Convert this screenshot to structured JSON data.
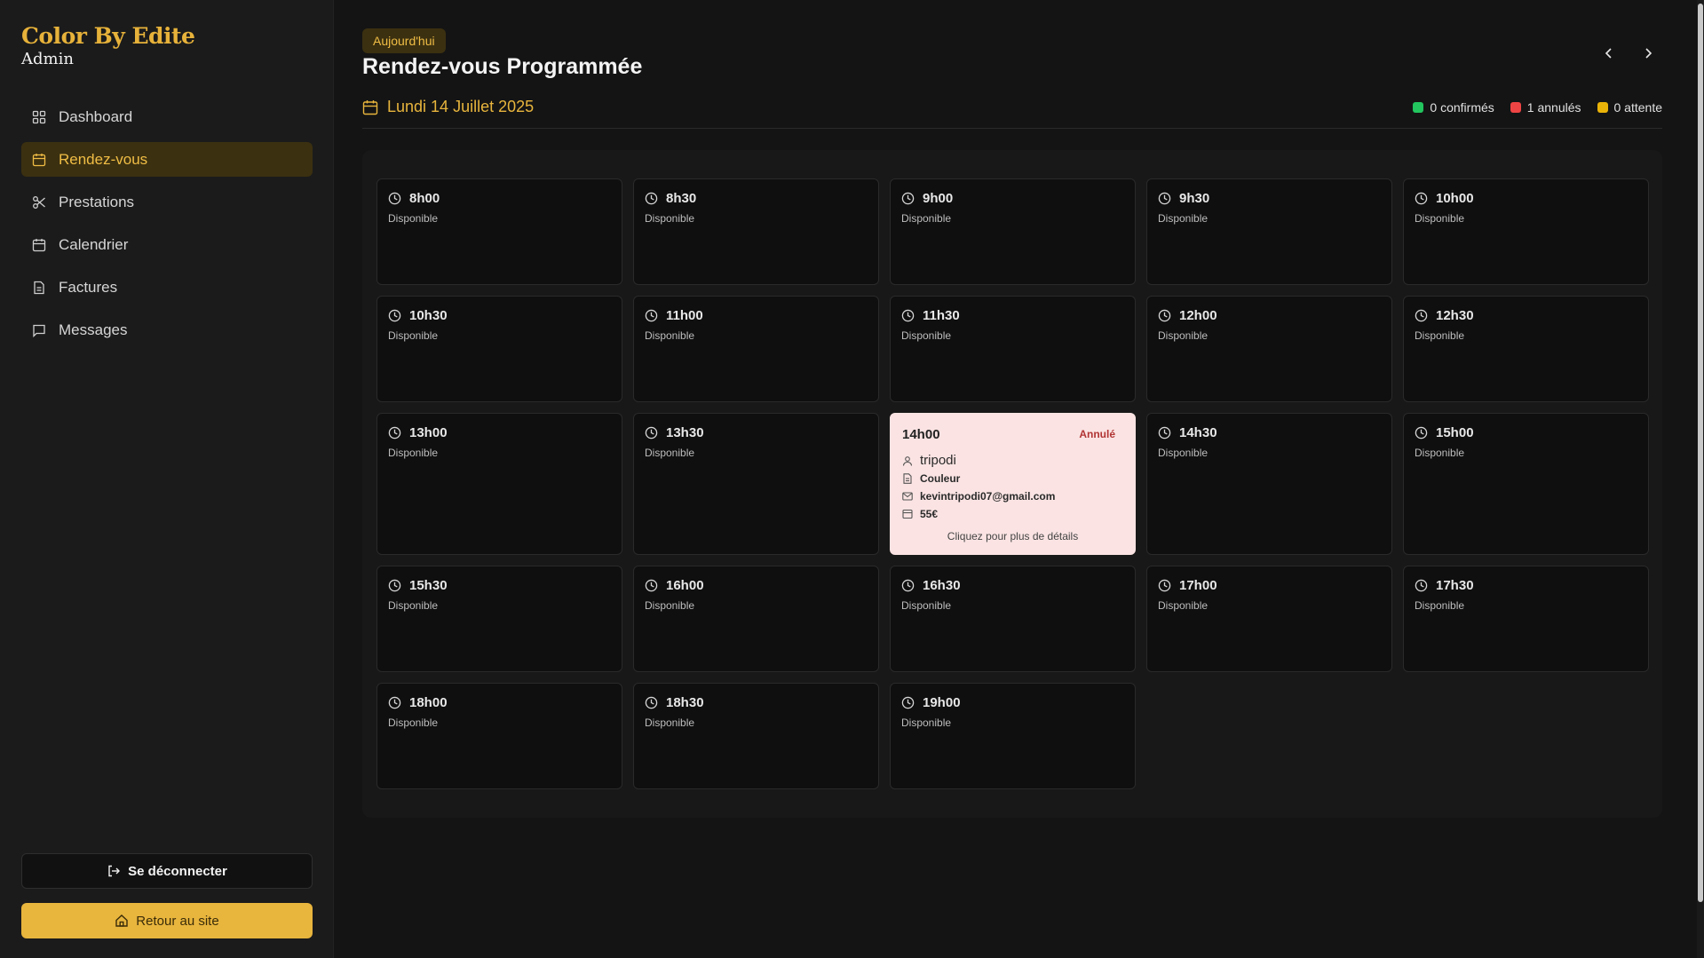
{
  "sidebar": {
    "brand_title": "Color By Edite",
    "brand_sub": "Admin",
    "items": [
      {
        "label": "Dashboard",
        "icon": "dashboard-icon"
      },
      {
        "label": "Rendez-vous",
        "icon": "calendar-icon",
        "active": true
      },
      {
        "label": "Prestations",
        "icon": "scissors-icon"
      },
      {
        "label": "Calendrier",
        "icon": "calendar-icon"
      },
      {
        "label": "Factures",
        "icon": "file-icon"
      },
      {
        "label": "Messages",
        "icon": "message-icon"
      }
    ],
    "logout_label": "Se déconnecter",
    "site_label": "Retour au site"
  },
  "header": {
    "badge": "Aujourd'hui",
    "title": "Rendez-vous Programmée",
    "date": "Lundi 14 Juillet 2025",
    "legend": {
      "confirmed": "0 confirmés",
      "cancelled": "1 annulés",
      "pending": "0 attente"
    }
  },
  "colors": {
    "accent": "#e8b53d",
    "confirmed": "#22c55e",
    "cancelled": "#ef4444",
    "pending": "#eab308"
  },
  "slots": [
    {
      "time": "8h00",
      "status": "Disponible"
    },
    {
      "time": "8h30",
      "status": "Disponible"
    },
    {
      "time": "9h00",
      "status": "Disponible"
    },
    {
      "time": "9h30",
      "status": "Disponible"
    },
    {
      "time": "10h00",
      "status": "Disponible"
    },
    {
      "time": "10h30",
      "status": "Disponible"
    },
    {
      "time": "11h00",
      "status": "Disponible"
    },
    {
      "time": "11h30",
      "status": "Disponible"
    },
    {
      "time": "12h00",
      "status": "Disponible"
    },
    {
      "time": "12h30",
      "status": "Disponible"
    },
    {
      "time": "13h00",
      "status": "Disponible"
    },
    {
      "time": "13h30",
      "status": "Disponible"
    },
    {
      "time": "14h00",
      "status": "Annulé",
      "client": "tripodi",
      "service": "Couleur",
      "email": "kevintripodi07@gmail.com",
      "price": "55€",
      "more": "Cliquez pour plus de détails"
    },
    {
      "time": "14h30",
      "status": "Disponible"
    },
    {
      "time": "15h00",
      "status": "Disponible"
    },
    {
      "time": "15h30",
      "status": "Disponible"
    },
    {
      "time": "16h00",
      "status": "Disponible"
    },
    {
      "time": "16h30",
      "status": "Disponible"
    },
    {
      "time": "17h00",
      "status": "Disponible"
    },
    {
      "time": "17h30",
      "status": "Disponible"
    },
    {
      "time": "18h00",
      "status": "Disponible"
    },
    {
      "time": "18h30",
      "status": "Disponible"
    },
    {
      "time": "19h00",
      "status": "Disponible"
    }
  ]
}
